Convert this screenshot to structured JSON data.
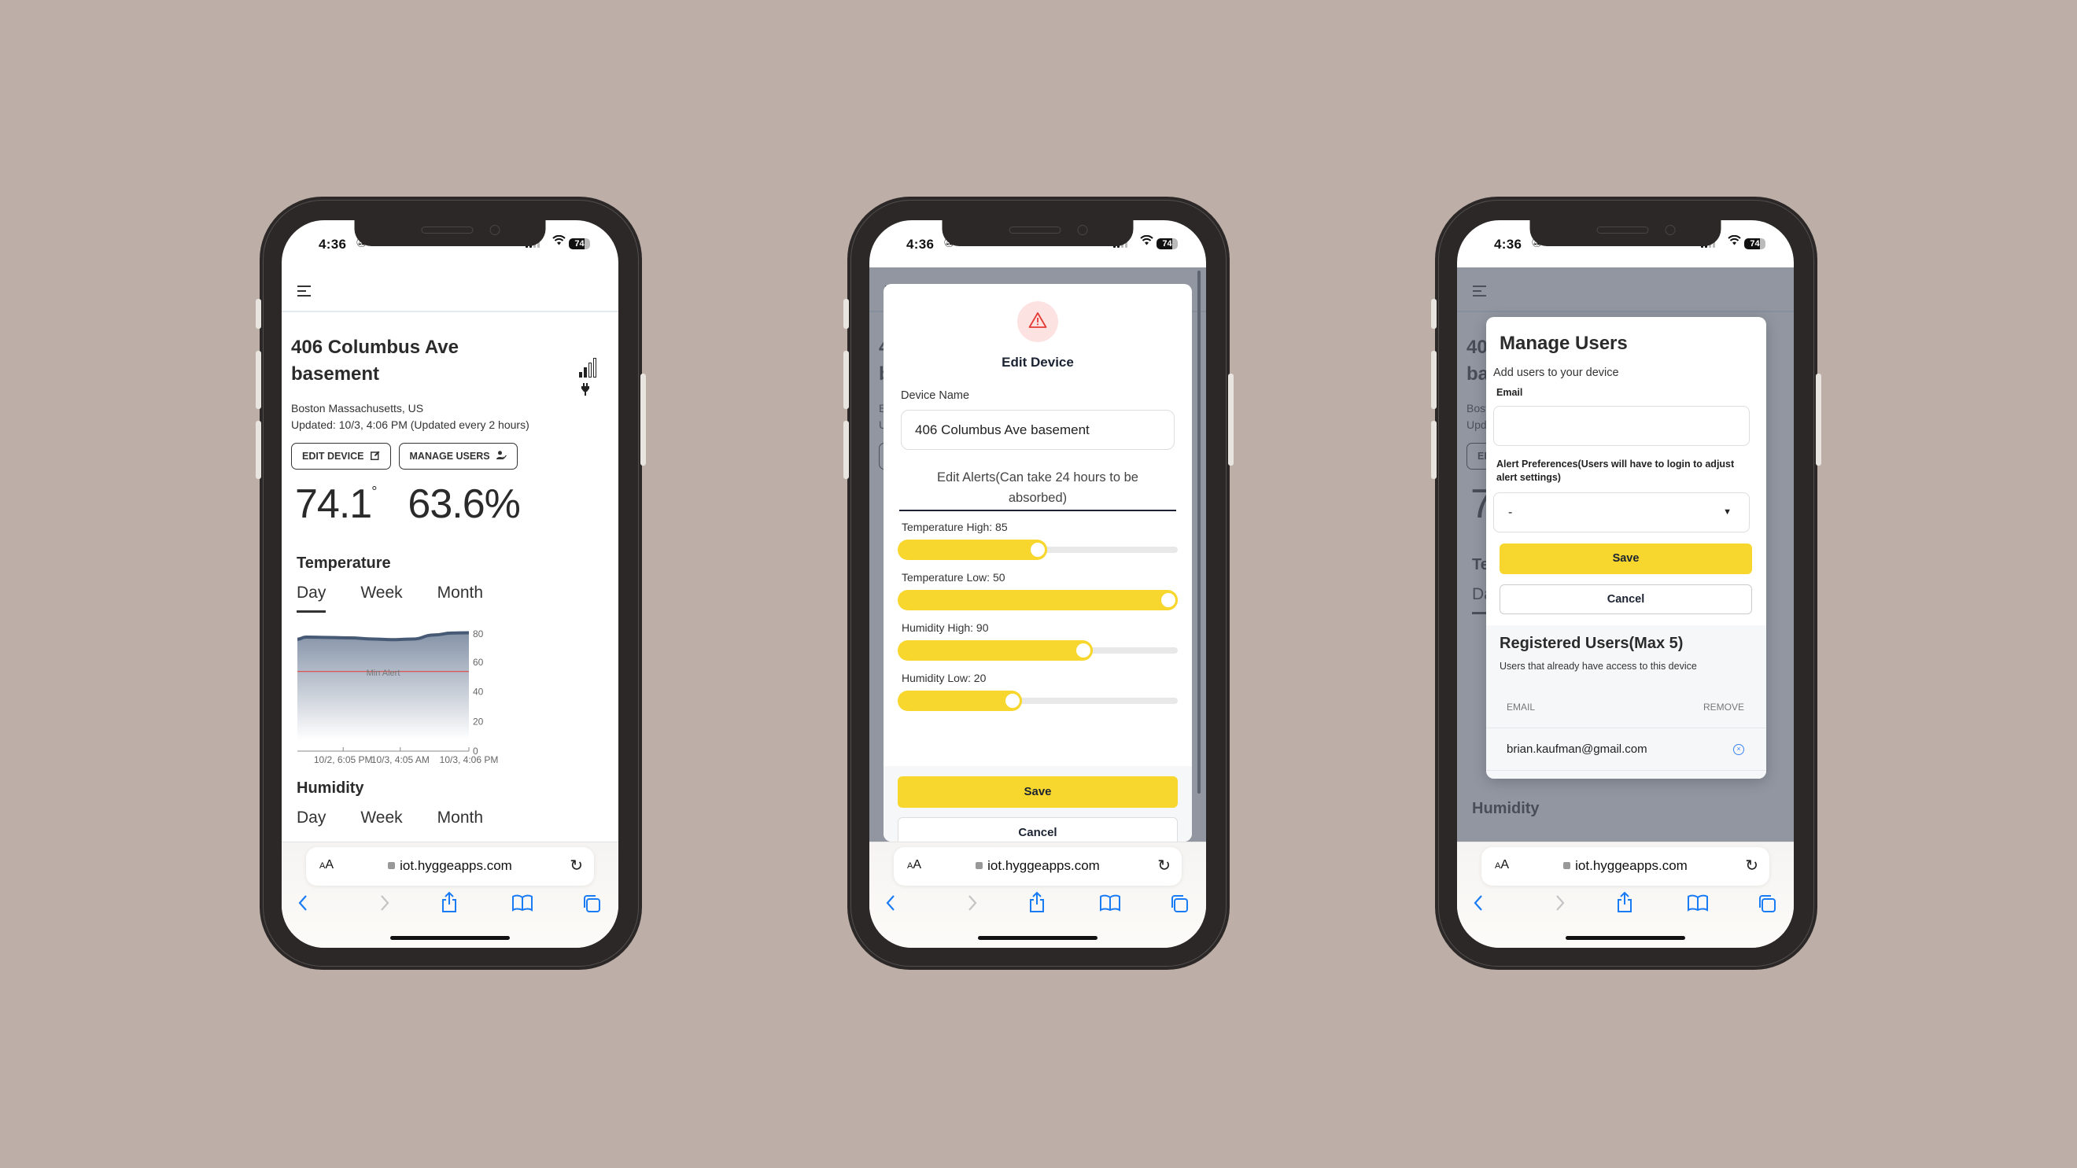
{
  "colors": {
    "background": "#bdaea7",
    "accent_yellow": "#f7d72e",
    "chart_line": "#475a75",
    "min_alert_line": "#e53935",
    "link_blue": "#1a7cf5"
  },
  "status_bar": {
    "time": "4:36",
    "battery": "74",
    "icons": [
      "bell-slash-icon",
      "cellular-signal-icon",
      "wifi-icon",
      "battery-icon"
    ]
  },
  "browser": {
    "aa_label_small": "A",
    "aa_label_large": "A",
    "url": "iot.hyggeapps.com",
    "icons": [
      "lock-icon",
      "reload-icon",
      "back-icon",
      "forward-icon",
      "share-icon",
      "bookmarks-icon",
      "tabs-icon"
    ]
  },
  "device": {
    "title": "406 Columbus Ave basement",
    "location": "Boston Massachusetts, US",
    "updated": "Updated: 10/3, 4:06 PM (Updated every 2 hours)",
    "edit_button": "EDIT DEVICE",
    "manage_button": "MANAGE USERS",
    "temperature": "74.1",
    "temperature_unit": "°",
    "humidity": "63.6%",
    "signal_strength_bars": 2,
    "signal_strength_max": 4
  },
  "temperature_section": {
    "title": "Temperature",
    "tabs": [
      "Day",
      "Week",
      "Month"
    ],
    "active_tab": "Day"
  },
  "humidity_section": {
    "title": "Humidity",
    "tabs": [
      "Day",
      "Week",
      "Month"
    ]
  },
  "chart_data": {
    "type": "area",
    "title": "Temperature",
    "xlabel": "",
    "ylabel": "",
    "x_ticks": [
      "10/2, 6:05 PM",
      "10/3, 4:05 AM",
      "10/3, 4:06 PM"
    ],
    "y_ticks": [
      0,
      20,
      40,
      60,
      80
    ],
    "ylim": [
      0,
      80
    ],
    "y_axis_side": "right",
    "grid": false,
    "x": [
      0,
      0.05,
      0.15,
      0.3,
      0.45,
      0.55,
      0.67,
      0.8,
      0.9,
      1.0
    ],
    "series": [
      {
        "name": "Temperature",
        "values": [
          72.5,
          74.0,
          73.8,
          73.4,
          72.6,
          72.2,
          72.6,
          75.5,
          76.8,
          77.0
        ]
      }
    ],
    "annotations": [
      {
        "type": "hline",
        "value": 50,
        "label": "Min Alert",
        "color": "#e53935"
      }
    ]
  },
  "edit_device_modal": {
    "title": "Edit Device",
    "icon": "warning-triangle-icon",
    "device_name_label": "Device Name",
    "device_name_value": "406 Columbus Ave basement",
    "alerts_heading": "Edit Alerts(Can take 24 hours to be absorbed)",
    "sliders": [
      {
        "label": "Temperature High: 85",
        "value": 85,
        "fill_fraction": 0.5
      },
      {
        "label": "Temperature Low: 50",
        "value": 50,
        "fill_fraction": 1.0
      },
      {
        "label": "Humidity High: 90",
        "value": 90,
        "fill_fraction": 0.675
      },
      {
        "label": "Humidity Low: 20",
        "value": 20,
        "fill_fraction": 0.405
      }
    ],
    "save_label": "Save",
    "cancel_label": "Cancel"
  },
  "manage_users_modal": {
    "title": "Manage Users",
    "subtitle": "Add users to your device",
    "email_label": "Email",
    "email_value": "",
    "alert_pref_label": "Alert Preferences(Users will have to login to adjust alert settings)",
    "alert_pref_value": "-",
    "save_label": "Save",
    "cancel_label": "Cancel",
    "registered_title": "Registered Users(Max 5)",
    "registered_subtitle": "Users that already have access to this device",
    "columns": [
      "EMAIL",
      "REMOVE"
    ],
    "users": [
      {
        "email": "brian.kaufman@gmail.com"
      }
    ]
  }
}
